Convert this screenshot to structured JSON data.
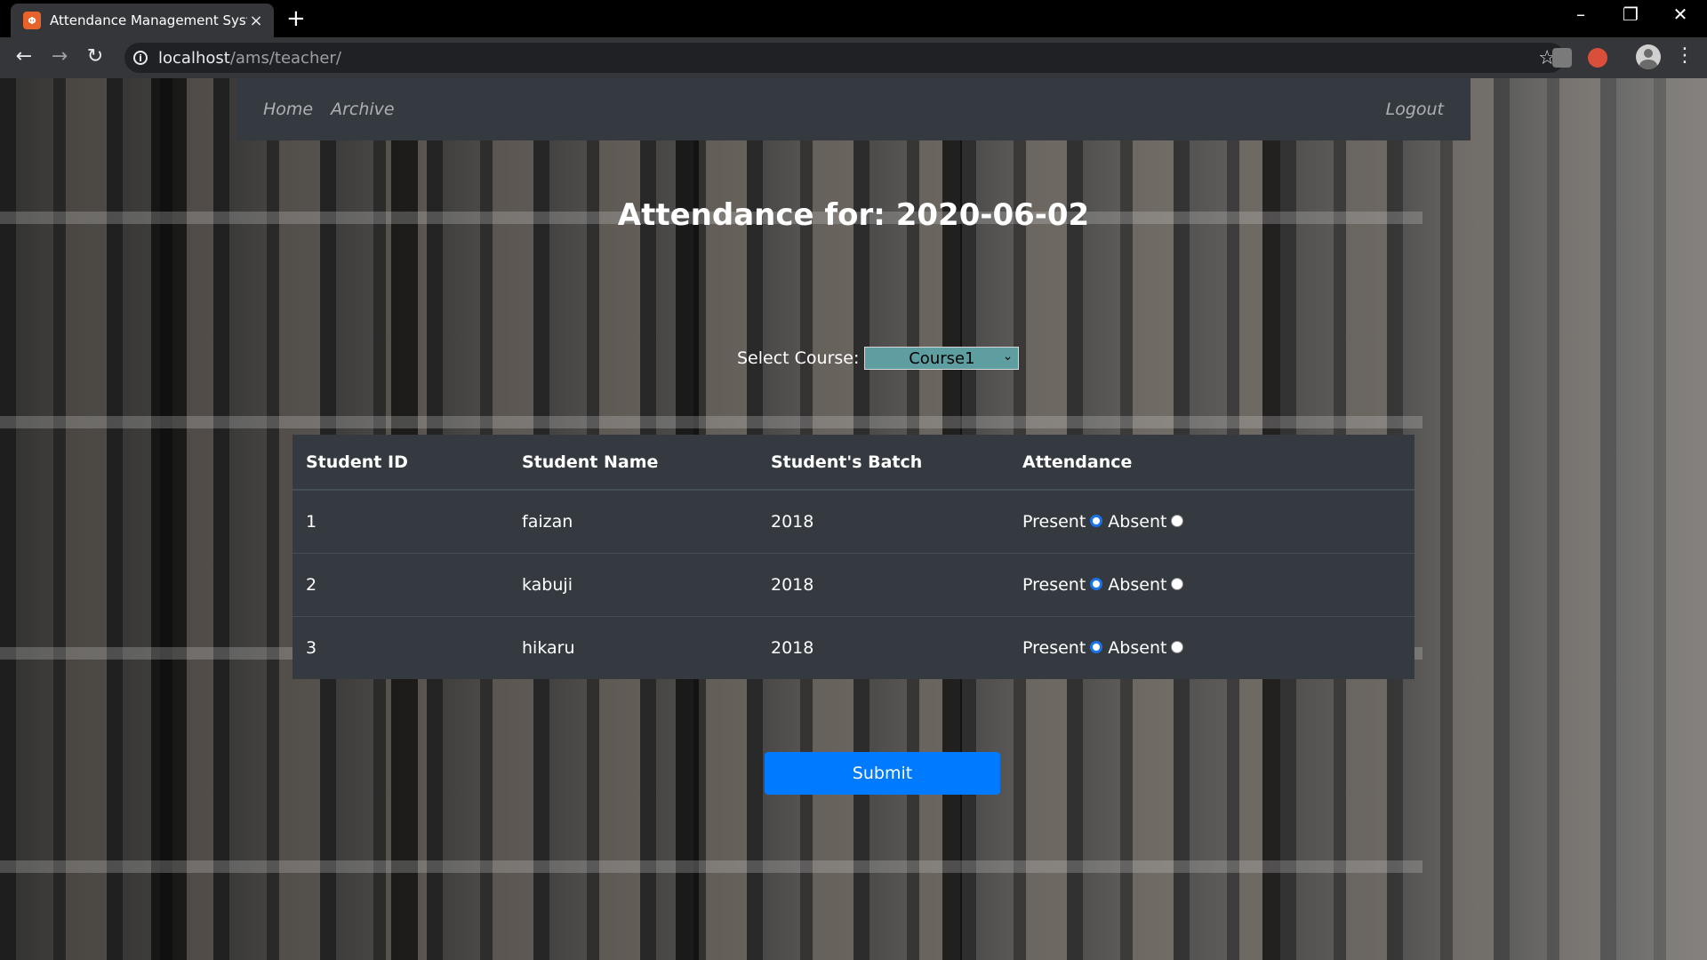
{
  "browser": {
    "tab_title": "Attendance Management System",
    "tab_favicon_text": "Φ",
    "url_host": "localhost",
    "url_path": "/ams/teacher/"
  },
  "nav": {
    "home": "Home",
    "archive": "Archive",
    "logout": "Logout"
  },
  "heading": "Attendance for: 2020-06-02",
  "course": {
    "label": "Select Course:",
    "selected": "Course1"
  },
  "table": {
    "headers": [
      "Student ID",
      "Student Name",
      "Student's Batch",
      "Attendance"
    ],
    "rows": [
      {
        "id": "1",
        "name": "faizan",
        "batch": "2018",
        "present_label": "Present",
        "absent_label": "Absent"
      },
      {
        "id": "2",
        "name": "kabuji",
        "batch": "2018",
        "present_label": "Present",
        "absent_label": "Absent"
      },
      {
        "id": "3",
        "name": "hikaru",
        "batch": "2018",
        "present_label": "Present",
        "absent_label": "Absent"
      }
    ]
  },
  "submit_label": "Submit",
  "colors": {
    "navbar": "#343a40",
    "select_bg": "#5f9ea0",
    "submit": "#007bff"
  }
}
